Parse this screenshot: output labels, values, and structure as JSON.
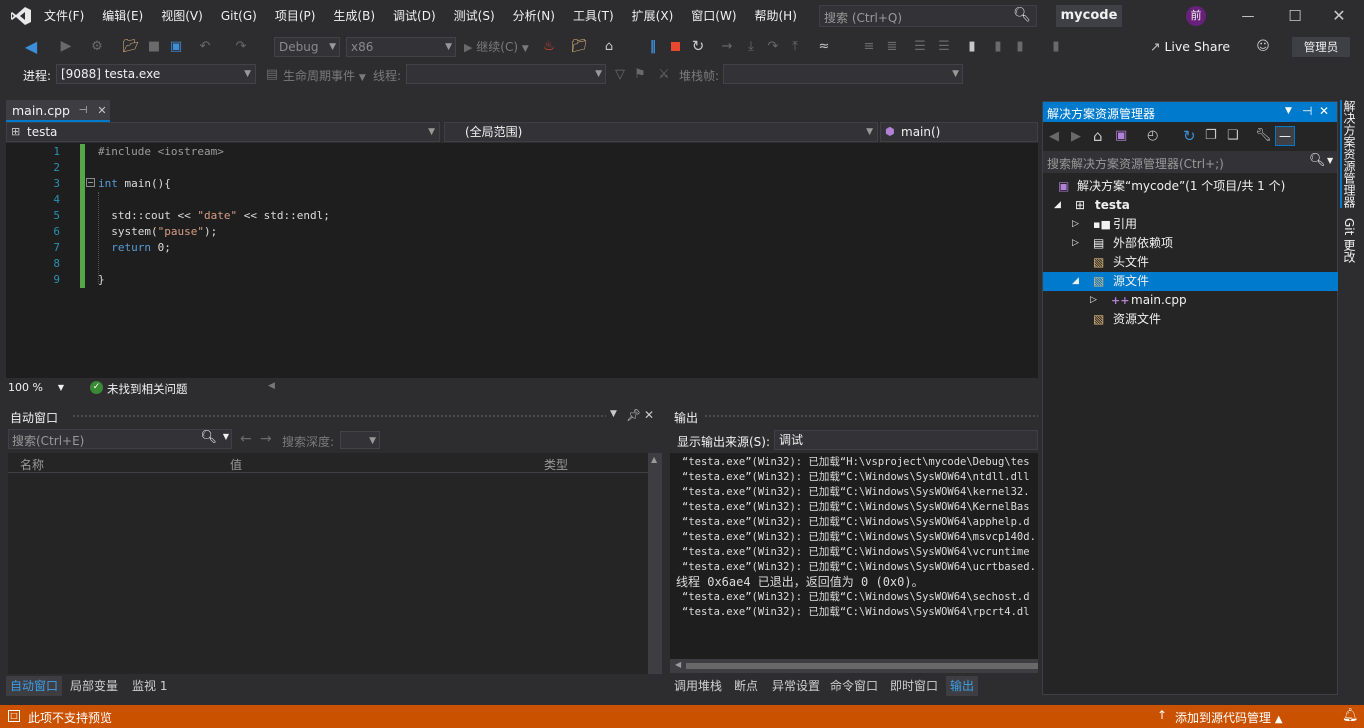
{
  "menu": {
    "items": [
      "文件(F)",
      "编辑(E)",
      "视图(V)",
      "Git(G)",
      "项目(P)",
      "生成(B)",
      "调试(D)",
      "测试(S)",
      "分析(N)",
      "工具(T)",
      "扩展(X)",
      "窗口(W)",
      "帮助(H)"
    ]
  },
  "search": {
    "placeholder": "搜索 (Ctrl+Q)"
  },
  "title": {
    "solution": "mycode",
    "avatar": "前"
  },
  "toolbar": {
    "config": "Debug",
    "platform": "x86",
    "continue": "继续(C)",
    "live_share": "Live Share",
    "admin": "管理员"
  },
  "debugbar": {
    "process_label": "进程:",
    "process": "[9088] testa.exe",
    "lifecycle": "生命周期事件",
    "thread_label": "线程:",
    "stack_label": "堆栈帧:"
  },
  "editor": {
    "tab": "main.cpp",
    "nav_project": "testa",
    "nav_scope": "(全局范围)",
    "nav_member": "main()",
    "line_numbers": [
      "1",
      "2",
      "3",
      "4",
      "5",
      "6",
      "7",
      "8",
      "9"
    ],
    "code": {
      "l1": "#include <iostream>",
      "l3_kw": "int",
      "l3_rest": " main(){",
      "l5_a": "std",
      "l5_b": "::cout << ",
      "l5_c": "\"date\"",
      "l5_d": " << ",
      "l5_e": "std",
      "l5_f": "::endl;",
      "l6_a": "system(",
      "l6_b": "\"pause\"",
      "l6_c": ");",
      "l7_kw": "return",
      "l7_rest": " 0;",
      "l9": "}"
    },
    "zoom": "100 %",
    "status": "未找到相关问题"
  },
  "autos": {
    "title": "自动窗口",
    "search_placeholder": "搜索(Ctrl+E)",
    "depth_label": "搜索深度:",
    "columns": {
      "name": "名称",
      "value": "值",
      "type": "类型"
    }
  },
  "output": {
    "title": "输出",
    "source_label": "显示输出来源(S):",
    "source": "调试",
    "lines": [
      "“testa.exe”(Win32): 已加载“H:\\vsproject\\mycode\\Debug\\tes",
      "“testa.exe”(Win32): 已加载“C:\\Windows\\SysWOW64\\ntdll.dll",
      "“testa.exe”(Win32): 已加载“C:\\Windows\\SysWOW64\\kernel32.",
      "“testa.exe”(Win32): 已加载“C:\\Windows\\SysWOW64\\KernelBas",
      "“testa.exe”(Win32): 已加载“C:\\Windows\\SysWOW64\\apphelp.d",
      "“testa.exe”(Win32): 已加载“C:\\Windows\\SysWOW64\\msvcp140d.",
      "“testa.exe”(Win32): 已加载“C:\\Windows\\SysWOW64\\vcruntime",
      "“testa.exe”(Win32): 已加载“C:\\Windows\\SysWOW64\\ucrtbased.",
      "线程 0x6ae4 已退出，返回值为 0 (0x0)。",
      "“testa.exe”(Win32): 已加载“C:\\Windows\\SysWOW64\\sechost.d",
      "“testa.exe”(Win32): 已加载“C:\\Windows\\SysWOW64\\rpcrt4.dl"
    ]
  },
  "bottom_tabs_left": [
    "自动窗口",
    "局部变量",
    "监视 1"
  ],
  "bottom_tabs_right": [
    "调用堆栈",
    "断点",
    "异常设置",
    "命令窗口",
    "即时窗口",
    "输出"
  ],
  "solution_explorer": {
    "title": "解决方案资源管理器",
    "search_placeholder": "搜索解决方案资源管理器(Ctrl+;)",
    "items": {
      "solution": "解决方案“mycode”(1 个项目/共 1 个)",
      "project": "testa",
      "refs": "引用",
      "ext": "外部依赖项",
      "headers": "头文件",
      "sources": "源文件",
      "main": "main.cpp",
      "resources": "资源文件"
    }
  },
  "side_tabs": {
    "se": "解决方案资源管理器",
    "git": "Git 更改"
  },
  "statusbar": {
    "left": "此项不支持预览",
    "right": "添加到源代码管理"
  },
  "colors": {
    "accent": "#007acc",
    "status": "#ca5100",
    "selection": "#3399ff"
  }
}
